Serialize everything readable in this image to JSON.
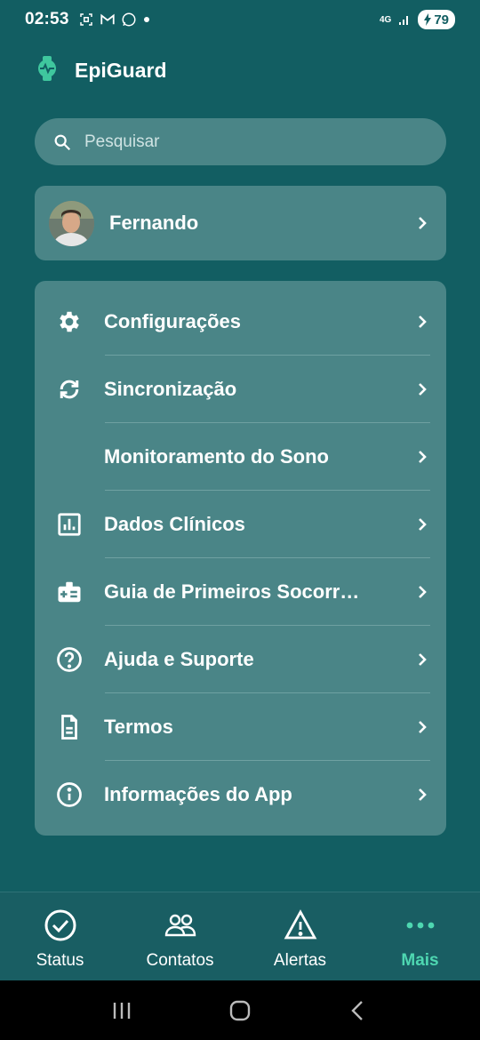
{
  "status_bar": {
    "time": "02:53",
    "network": "4G",
    "battery": "79"
  },
  "app": {
    "title": "EpiGuard",
    "accent_color": "#4ed7b1",
    "background_color": "#125e62",
    "card_color": "#4a8587"
  },
  "search": {
    "placeholder": "Pesquisar",
    "icon": "search-icon"
  },
  "profile": {
    "name": "Fernando"
  },
  "menu": {
    "items": [
      {
        "label": "Configurações",
        "icon": "gear-icon"
      },
      {
        "label": "Sincronização",
        "icon": "sync-icon"
      },
      {
        "label": "Monitoramento do Sono",
        "icon": "moon-icon"
      },
      {
        "label": "Dados Clínicos",
        "icon": "bar-chart-icon"
      },
      {
        "label": "Guia de Primeiros Socorr…",
        "icon": "first-aid-icon"
      },
      {
        "label": "Ajuda e Suporte",
        "icon": "help-icon"
      },
      {
        "label": "Termos",
        "icon": "document-icon"
      },
      {
        "label": "Informações do App",
        "icon": "info-icon"
      }
    ]
  },
  "bottom_nav": {
    "items": [
      {
        "label": "Status",
        "icon": "check-circle-icon",
        "active": false
      },
      {
        "label": "Contatos",
        "icon": "people-icon",
        "active": false
      },
      {
        "label": "Alertas",
        "icon": "warning-icon",
        "active": false
      },
      {
        "label": "Mais",
        "icon": "more-dots-icon",
        "active": true
      }
    ]
  }
}
